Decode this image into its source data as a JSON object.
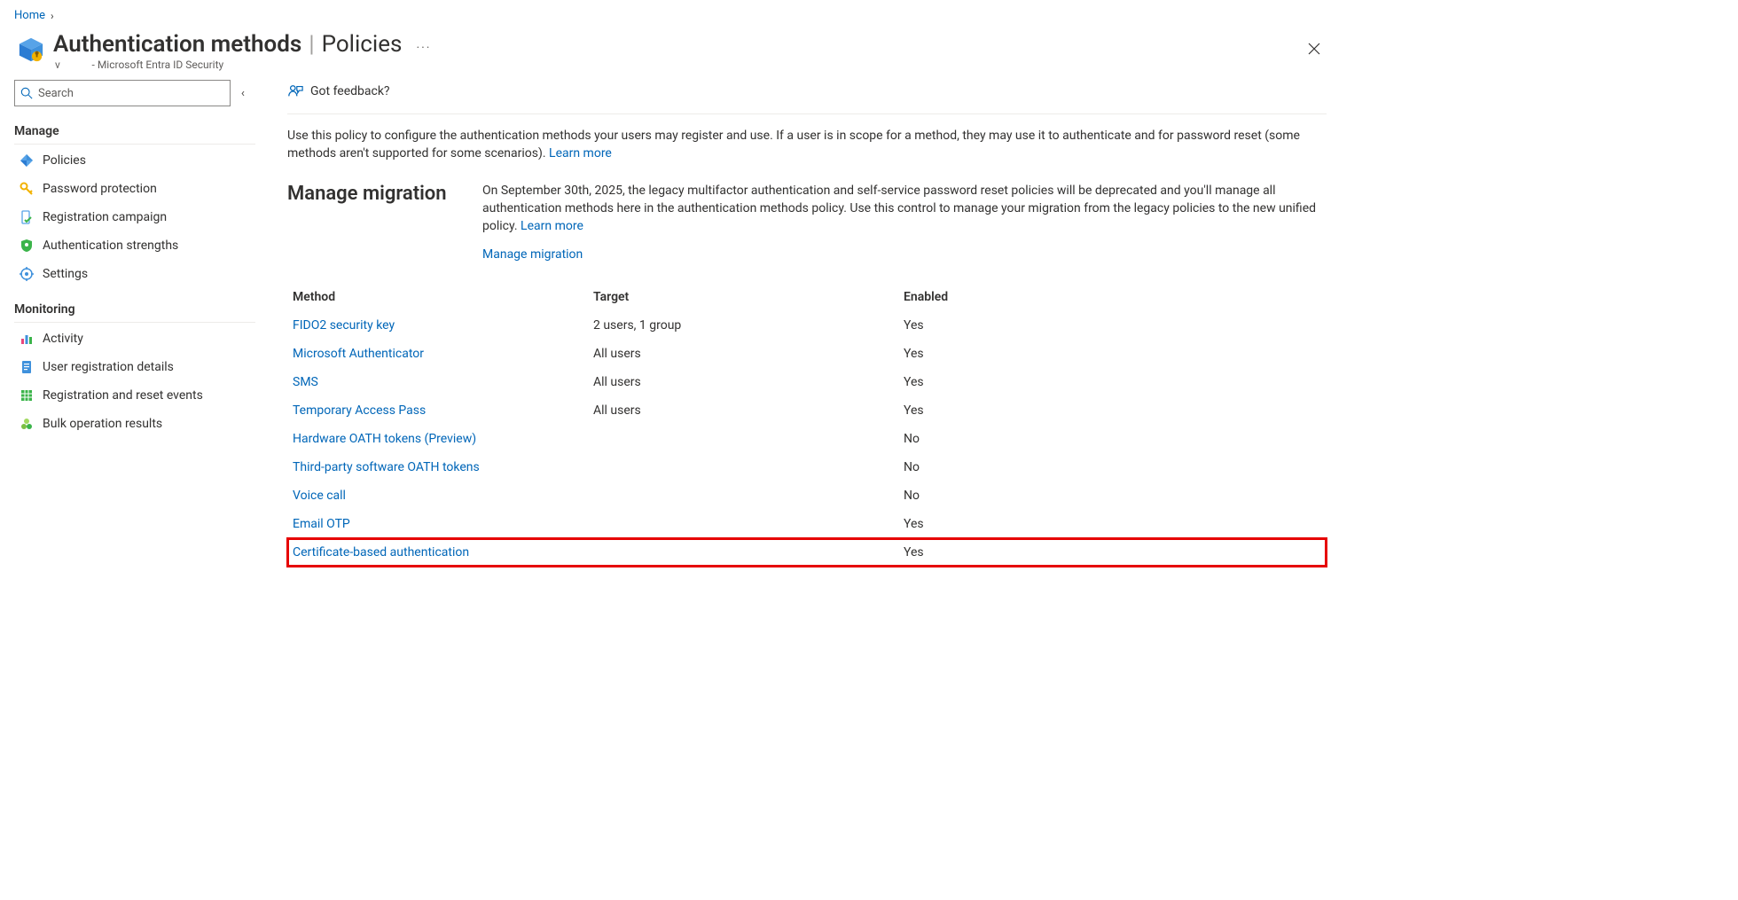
{
  "breadcrumb": {
    "home": "Home"
  },
  "header": {
    "title": "Authentication methods",
    "section": "Policies",
    "scope_prefix": "v",
    "scope_suffix": "- Microsoft Entra ID Security",
    "ellipsis": "···"
  },
  "sidebar": {
    "search_placeholder": "Search",
    "groups": {
      "manage": {
        "title": "Manage",
        "items": [
          {
            "label": "Policies"
          },
          {
            "label": "Password protection"
          },
          {
            "label": "Registration campaign"
          },
          {
            "label": "Authentication strengths"
          },
          {
            "label": "Settings"
          }
        ]
      },
      "monitoring": {
        "title": "Monitoring",
        "items": [
          {
            "label": "Activity"
          },
          {
            "label": "User registration details"
          },
          {
            "label": "Registration and reset events"
          },
          {
            "label": "Bulk operation results"
          }
        ]
      }
    }
  },
  "toolbar": {
    "feedback": "Got feedback?"
  },
  "intro": {
    "text": "Use this policy to configure the authentication methods your users may register and use. If a user is in scope for a method, they may use it to authenticate and for password reset (some methods aren't supported for some scenarios). ",
    "learn_more": "Learn more"
  },
  "migration": {
    "heading": "Manage migration",
    "body": "On September 30th, 2025, the legacy multifactor authentication and self-service password reset policies will be deprecated and you'll manage all authentication methods here in the authentication methods policy. Use this control to manage your migration from the legacy policies to the new unified policy. ",
    "learn_more": "Learn more",
    "action": "Manage migration"
  },
  "table": {
    "headers": {
      "method": "Method",
      "target": "Target",
      "enabled": "Enabled"
    },
    "rows": [
      {
        "method": "FIDO2 security key",
        "target": "2 users, 1 group",
        "enabled": "Yes"
      },
      {
        "method": "Microsoft Authenticator",
        "target": "All users",
        "enabled": "Yes"
      },
      {
        "method": "SMS",
        "target": "All users",
        "enabled": "Yes"
      },
      {
        "method": "Temporary Access Pass",
        "target": "All users",
        "enabled": "Yes"
      },
      {
        "method": "Hardware OATH tokens (Preview)",
        "target": "",
        "enabled": "No"
      },
      {
        "method": "Third-party software OATH tokens",
        "target": "",
        "enabled": "No"
      },
      {
        "method": "Voice call",
        "target": "",
        "enabled": "No"
      },
      {
        "method": "Email OTP",
        "target": "",
        "enabled": "Yes"
      },
      {
        "method": "Certificate-based authentication",
        "target": "",
        "enabled": "Yes",
        "highlight": true
      }
    ]
  }
}
